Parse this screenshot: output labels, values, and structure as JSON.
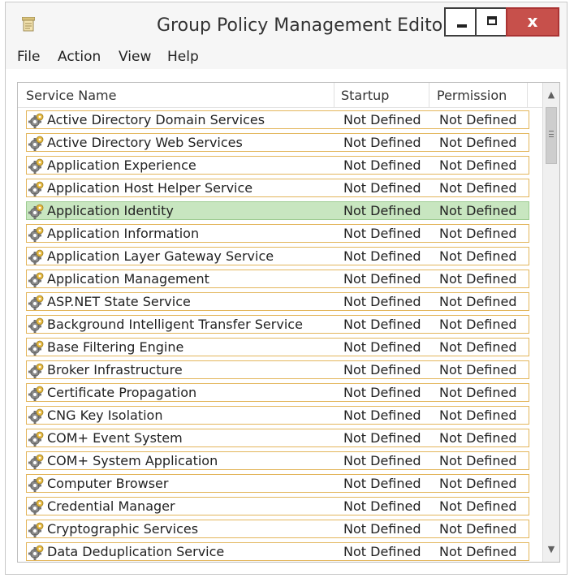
{
  "window": {
    "title": "Group Policy Management Editor",
    "controls": {
      "close_label": "x"
    }
  },
  "menu": {
    "items": [
      "File",
      "Action",
      "View",
      "Help"
    ]
  },
  "columns": [
    "Service Name",
    "Startup",
    "Permission"
  ],
  "selected_index": 4,
  "rows": [
    {
      "name": "Active Directory Domain Services",
      "startup": "Not Defined",
      "permission": "Not Defined"
    },
    {
      "name": "Active Directory Web Services",
      "startup": "Not Defined",
      "permission": "Not Defined"
    },
    {
      "name": "Application Experience",
      "startup": "Not Defined",
      "permission": "Not Defined"
    },
    {
      "name": "Application Host Helper Service",
      "startup": "Not Defined",
      "permission": "Not Defined"
    },
    {
      "name": "Application Identity",
      "startup": "Not Defined",
      "permission": "Not Defined"
    },
    {
      "name": "Application Information",
      "startup": "Not Defined",
      "permission": "Not Defined"
    },
    {
      "name": "Application Layer Gateway Service",
      "startup": "Not Defined",
      "permission": "Not Defined"
    },
    {
      "name": "Application Management",
      "startup": "Not Defined",
      "permission": "Not Defined"
    },
    {
      "name": "ASP.NET State Service",
      "startup": "Not Defined",
      "permission": "Not Defined"
    },
    {
      "name": "Background Intelligent Transfer Service",
      "startup": "Not Defined",
      "permission": "Not Defined"
    },
    {
      "name": "Base Filtering Engine",
      "startup": "Not Defined",
      "permission": "Not Defined"
    },
    {
      "name": "Broker Infrastructure",
      "startup": "Not Defined",
      "permission": "Not Defined"
    },
    {
      "name": "Certificate Propagation",
      "startup": "Not Defined",
      "permission": "Not Defined"
    },
    {
      "name": "CNG Key Isolation",
      "startup": "Not Defined",
      "permission": "Not Defined"
    },
    {
      "name": "COM+ Event System",
      "startup": "Not Defined",
      "permission": "Not Defined"
    },
    {
      "name": "COM+ System Application",
      "startup": "Not Defined",
      "permission": "Not Defined"
    },
    {
      "name": "Computer Browser",
      "startup": "Not Defined",
      "permission": "Not Defined"
    },
    {
      "name": "Credential Manager",
      "startup": "Not Defined",
      "permission": "Not Defined"
    },
    {
      "name": "Cryptographic Services",
      "startup": "Not Defined",
      "permission": "Not Defined"
    },
    {
      "name": "Data Deduplication Service",
      "startup": "Not Defined",
      "permission": "Not Defined"
    }
  ],
  "icons": {
    "app": "policy-document-icon",
    "row": "service-gear-icon",
    "scroll_up": "chevron-up-icon",
    "scroll_down": "chevron-down-icon"
  },
  "colors": {
    "row_border": "#e3b65c",
    "selected_row": "#c8e6c0",
    "close_button": "#c7504b"
  }
}
